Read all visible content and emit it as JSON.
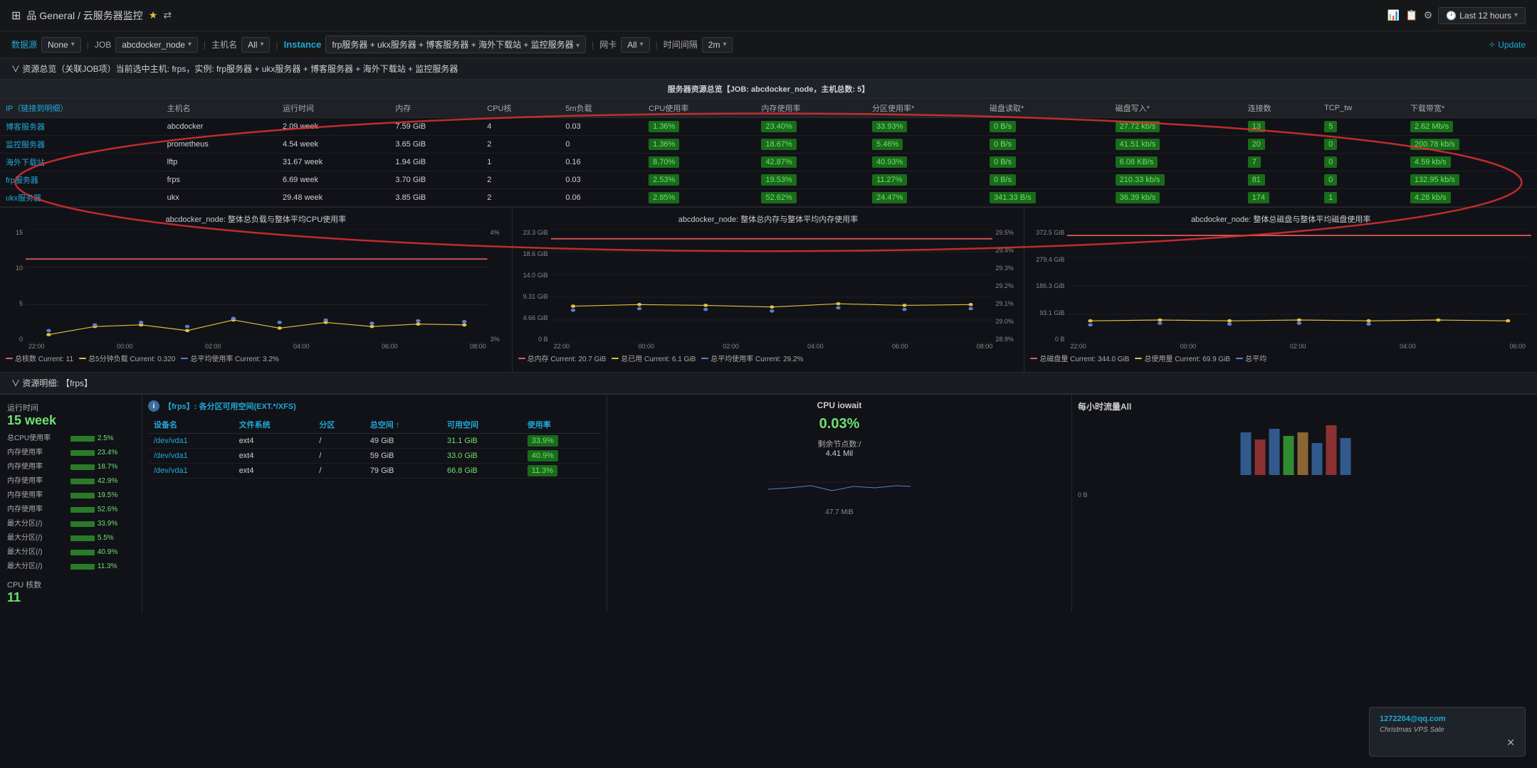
{
  "header": {
    "breadcrumb": "品 General / 云服务器监控",
    "star_icon": "★",
    "share_icon": "⇄",
    "time_label": "Last 12 hours",
    "right_icons": [
      "chart-icon",
      "copy-icon",
      "settings-icon",
      "clock-icon"
    ]
  },
  "toolbar": {
    "source_label": "数据源",
    "source_value": "None",
    "job_label": "JOB",
    "job_value": "abcdocker_node",
    "host_label": "主机名",
    "host_value": "All",
    "instance_label": "Instance",
    "instance_filter": "frp服务器 + ukx服务器 + 博客服务器 + 海外下载站 + 监控服务器",
    "nic_label": "网卡",
    "nic_value": "All",
    "interval_label": "时间间隔",
    "interval_value": "2m",
    "update_label": "✧ Update"
  },
  "summary_section": {
    "header": "∨ 资源总览（关联JOB项）当前选中主机: frps，实例: frp服务器 + ukx服务器 + 博客服务器 + 海外下载站 + 监控服务器",
    "table_title": "服务器资源总览【JOB: abcdocker_node，主机总数: 5】",
    "columns": [
      "IP（链接到明细）",
      "主机名",
      "运行时间",
      "内存",
      "CPU核",
      "5m负载",
      "CPU使用率",
      "内存使用率",
      "分区使用率*",
      "磁盘读取*",
      "磁盘写入*",
      "连接数",
      "TCP_tw",
      "下载带宽*"
    ],
    "rows": [
      {
        "ip": "博客服务器",
        "hostname": "abcdocker",
        "uptime": "2.09 week",
        "mem": "7.59 GiB",
        "cpu": "4",
        "load5m": "0.03",
        "cpu_pct": "1.36%",
        "mem_pct": "23.40%",
        "disk_pct": "33.93%",
        "disk_read": "0 B/s",
        "disk_write": "27.72 kb/s",
        "connections": "13",
        "tcp_tw": "5",
        "download": "2.62 Mb/s"
      },
      {
        "ip": "监控服务器",
        "hostname": "prometheus",
        "uptime": "4.54 week",
        "mem": "3.65 GiB",
        "cpu": "2",
        "load5m": "0",
        "cpu_pct": "1.36%",
        "mem_pct": "18.67%",
        "disk_pct": "5.46%",
        "disk_read": "0 B/s",
        "disk_write": "41.51 kb/s",
        "connections": "20",
        "tcp_tw": "0",
        "download": "200.78 kb/s"
      },
      {
        "ip": "海外下载站",
        "hostname": "lftp",
        "uptime": "31.67 week",
        "mem": "1.94 GiB",
        "cpu": "1",
        "load5m": "0.16",
        "cpu_pct": "8.70%",
        "mem_pct": "42.87%",
        "disk_pct": "40.93%",
        "disk_read": "0 B/s",
        "disk_write": "6.08 KB/s",
        "connections": "7",
        "tcp_tw": "0",
        "download": "4.59 kb/s"
      },
      {
        "ip": "frp服务器",
        "hostname": "frps",
        "uptime": "6.69 week",
        "mem": "3.70 GiB",
        "cpu": "2",
        "load5m": "0.03",
        "cpu_pct": "2.53%",
        "mem_pct": "19.53%",
        "disk_pct": "11.27%",
        "disk_read": "0 B/s",
        "disk_write": "210.33 kb/s",
        "connections": "81",
        "tcp_tw": "0",
        "download": "132.95 kb/s"
      },
      {
        "ip": "ukx服务器",
        "hostname": "ukx",
        "uptime": "29.48 week",
        "mem": "3.85 GiB",
        "cpu": "2",
        "load5m": "0.06",
        "cpu_pct": "2.85%",
        "mem_pct": "52.62%",
        "disk_pct": "24.47%",
        "disk_read": "341.33 B/s",
        "disk_write": "36.39 kb/s",
        "connections": "174",
        "tcp_tw": "1",
        "download": "4.28 kb/s"
      }
    ]
  },
  "charts": {
    "cpu_chart": {
      "title": "abcdocker_node: 整体总负载与整体平均CPU使用率",
      "y_labels": [
        "15",
        "10",
        "5",
        "0"
      ],
      "y_labels_right": [
        "4%",
        "3%"
      ],
      "x_labels": [
        "22:00",
        "00:00",
        "02:00",
        "04:00",
        "06:00",
        "08:00"
      ],
      "legend": [
        {
          "label": "总核数 Current: 11",
          "color": "red"
        },
        {
          "label": "总5分钟负载 Current: 0.320",
          "color": "yellow"
        },
        {
          "label": "总平均使用率 Current: 3.2%",
          "color": "blue"
        }
      ]
    },
    "mem_chart": {
      "title": "abcdocker_node: 整体总内存与整体平均内存使用率",
      "y_labels": [
        "23.3 GiB",
        "18.6 GiB",
        "14.0 GiB",
        "9.31 GiB",
        "4.66 GiB",
        "0 B"
      ],
      "y_labels_right": [],
      "x_labels": [
        "22:00",
        "00:00",
        "02:00",
        "04:00",
        "06:00",
        "08:00"
      ],
      "legend": [
        {
          "label": "总内存 Current: 20.7 GiB",
          "color": "red"
        },
        {
          "label": "总已用 Current: 6.1 GiB",
          "color": "yellow"
        },
        {
          "label": "总平均使用率 Current: 29.2%",
          "color": "blue"
        }
      ]
    },
    "disk_chart": {
      "title": "abcdocker_node: 整体总磁盘与整体平均磁盘使用率",
      "y_labels": [
        "372.5 GiB",
        "279.4 GiB",
        "186.3 GiB",
        "93.1 GiB",
        "0 B"
      ],
      "x_labels": [
        "22:00",
        "00:00",
        "02:00",
        "04:00",
        "06:00"
      ],
      "legend": [
        {
          "label": "总磁盘量 Current: 344.0 GiB",
          "color": "red"
        },
        {
          "label": "总使用量 Current: 69.9 GiB",
          "color": "yellow"
        },
        {
          "label": "总平均",
          "color": "blue"
        }
      ]
    }
  },
  "detail_section": {
    "header": "∨ 资源明细: 【frps】",
    "left_panel": {
      "uptime_label": "运行时间",
      "uptime_value": "15 week",
      "cpu_label": "CPU 核数",
      "cpu_value": "11",
      "metrics": [
        {
          "label": "总CPU使用率",
          "bar_pct": 25,
          "value": "2.5%"
        },
        {
          "label": "内存使用率",
          "bar_pct": 23,
          "value": "23.4%"
        },
        {
          "label": "内存使用率",
          "bar_pct": 19,
          "value": "18.7%"
        },
        {
          "label": "内存使用率",
          "bar_pct": 43,
          "value": "42.9%"
        },
        {
          "label": "内存使用率",
          "bar_pct": 20,
          "value": "19.5%"
        },
        {
          "label": "内存使用率",
          "bar_pct": 53,
          "value": "52.6%"
        },
        {
          "label": "最大分区(/)",
          "bar_pct": 34,
          "value": "33.9%"
        },
        {
          "label": "最大分区(/)",
          "bar_pct": 6,
          "value": "5.5%"
        },
        {
          "label": "最大分区(/)",
          "bar_pct": 41,
          "value": "40.9%"
        },
        {
          "label": "最大分区(/)",
          "bar_pct": 11,
          "value": "11.3%"
        }
      ]
    },
    "disk_table": {
      "title": "【frps】: 各分区可用空间(EXT.*/XFS)",
      "columns": [
        "设备名",
        "文件系统",
        "分区",
        "总空间 ↑",
        "可用空间",
        "使用率"
      ],
      "rows": [
        {
          "device": "/dev/vda1",
          "fs": "ext4",
          "partition": "/",
          "total": "49 GiB",
          "avail": "31.1 GiB",
          "usage": "33.9%",
          "usage_color": "green"
        },
        {
          "device": "/dev/vda1",
          "fs": "ext4",
          "partition": "/",
          "total": "59 GiB",
          "avail": "33.0 GiB",
          "usage": "40.9%",
          "usage_color": "green"
        },
        {
          "device": "/dev/vda1",
          "fs": "ext4",
          "partition": "/",
          "total": "79 GiB",
          "avail": "66.8 GiB",
          "usage": "11.3%",
          "usage_color": "green"
        }
      ]
    },
    "cpu_iowait": {
      "title": "CPU iowait",
      "value": "0.03%",
      "subtitle": "剩余节点数:/",
      "sub_value": "4.41 Mil"
    },
    "traffic_title": "每小时流量All"
  },
  "notification": {
    "title": "1272204@qq.com",
    "content": "Christmas VPS Sale"
  }
}
